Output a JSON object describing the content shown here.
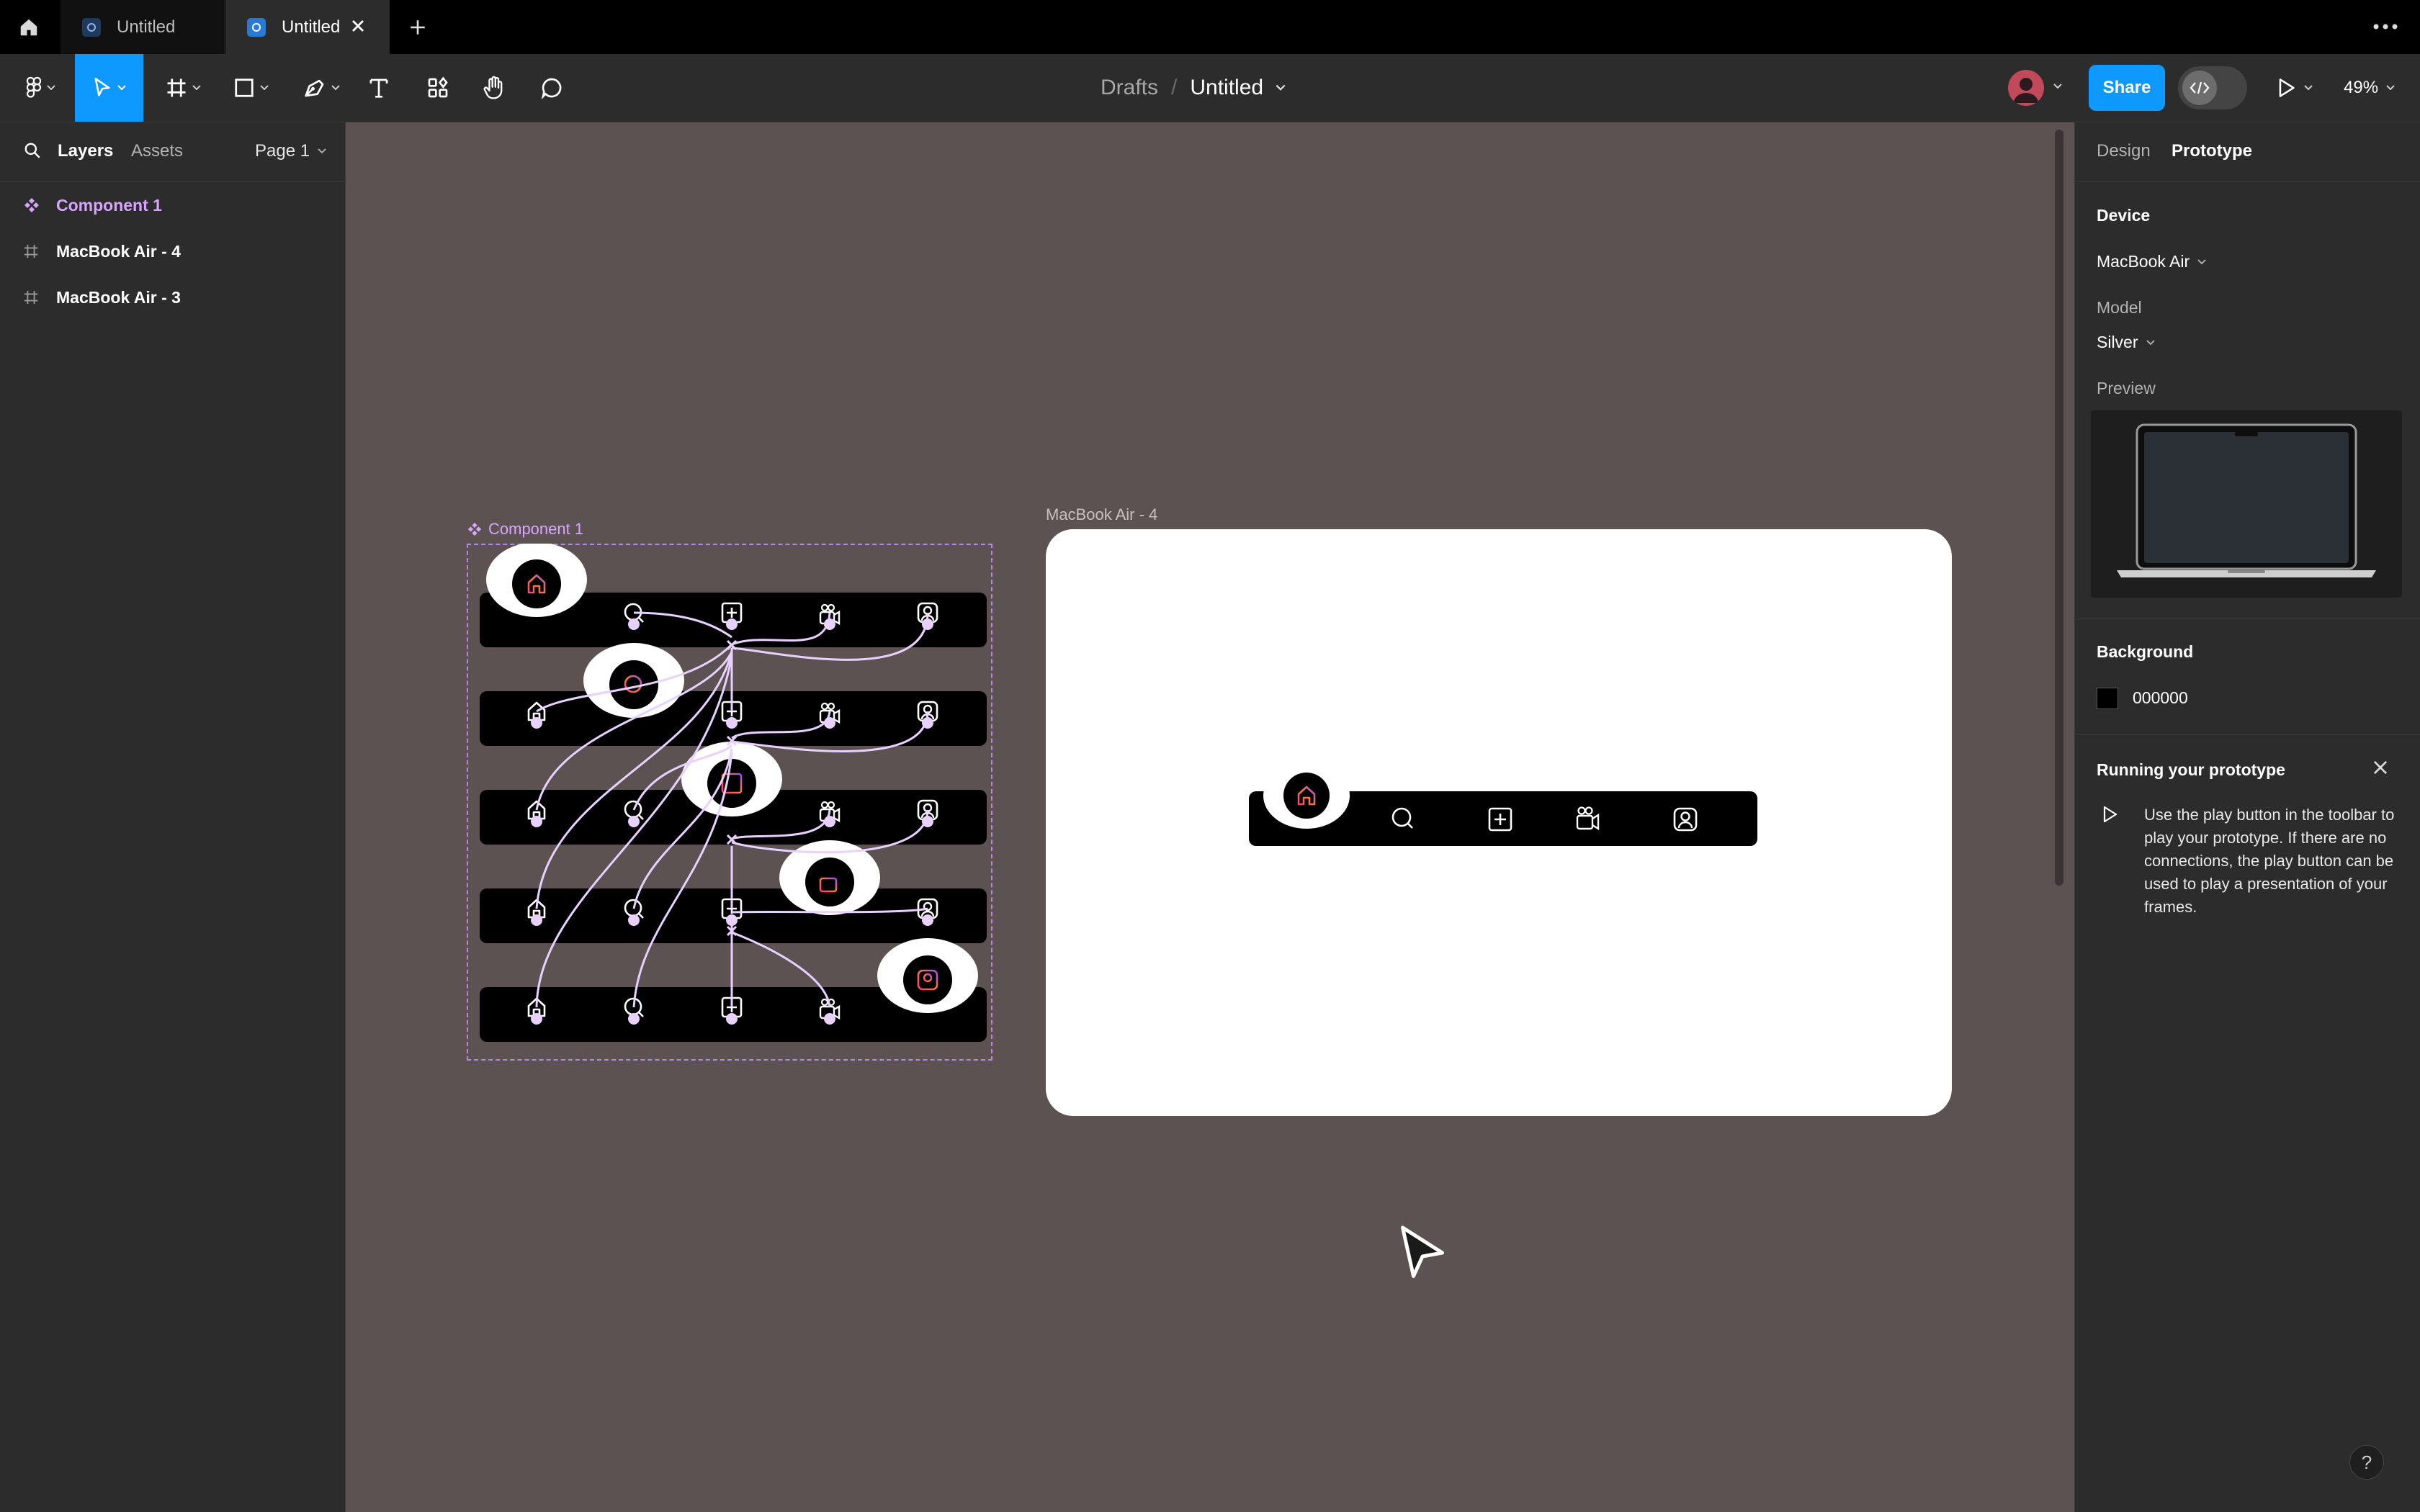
{
  "tabs": [
    {
      "label": "Untitled",
      "active": false
    },
    {
      "label": "Untitled",
      "active": true
    }
  ],
  "toolbar": {
    "breadcrumb_root": "Drafts",
    "breadcrumb_separator": "/",
    "file_name": "Untitled",
    "share_label": "Share",
    "zoom": "49%"
  },
  "left_panel": {
    "tab_layers": "Layers",
    "tab_assets": "Assets",
    "page": "Page 1",
    "layers": [
      {
        "label": "Component 1",
        "kind": "component"
      },
      {
        "label": "MacBook Air - 4",
        "kind": "frame"
      },
      {
        "label": "MacBook Air - 3",
        "kind": "frame"
      }
    ]
  },
  "canvas": {
    "component_label": "Component 1",
    "frame_label": "MacBook Air - 4",
    "background": "#5c5251",
    "variant_count": 5,
    "nav_icons": [
      "home-icon",
      "search-icon",
      "plus-square-icon",
      "video-icon",
      "profile-icon"
    ]
  },
  "right_panel": {
    "tab_design": "Design",
    "tab_prototype": "Prototype",
    "device_heading": "Device",
    "device_value": "MacBook Air",
    "model_label": "Model",
    "model_value": "Silver",
    "preview_label": "Preview",
    "background_heading": "Background",
    "background_hex": "000000",
    "running_heading": "Running your prototype",
    "running_text": "Use the play button in the toolbar to play your prototype. If there are no connections, the play button can be used to play a presentation of your frames."
  },
  "colors": {
    "accent": "#0d99ff",
    "component": "#d7a4ff",
    "connector": "#e8d0ff"
  }
}
